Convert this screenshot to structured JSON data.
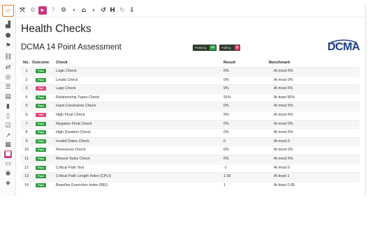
{
  "toolbar": {
    "icons": [
      "expand-icon",
      "settings-icon",
      "play-icon",
      "help-icon",
      "gear-icon",
      "back-icon",
      "home-icon",
      "forward-icon",
      "undo-icon",
      "history-icon",
      "refresh-icon",
      "download-icon"
    ]
  },
  "sidebar": {
    "icons": [
      "logo-icon",
      "chart-icon",
      "team-icon",
      "flag-icon",
      "link-icon",
      "resources-icon",
      "target-icon",
      "list-icon",
      "document-icon",
      "book-icon",
      "hint-icon",
      "check-icon",
      "trend-icon",
      "calendar-icon",
      "health-check-icon",
      "message-icon",
      "eye-icon",
      "chat-icon"
    ]
  },
  "page": {
    "title": "Health Checks",
    "subtitle": "DCMA 14 Point Assessment",
    "passing_label": "Passing",
    "passing_count": "12",
    "failing_label": "Failing",
    "failing_count": "2",
    "logo_text": "DCMA"
  },
  "table": {
    "headers": {
      "no": "No.",
      "outcome": "Outcome",
      "check": "Check",
      "result": "Result",
      "benchmark": "Benchmark"
    },
    "rows": [
      {
        "no": "1",
        "outcome": "Pass",
        "check": "Logic Check",
        "result": "0%",
        "benchmark": "At most 5%"
      },
      {
        "no": "2",
        "outcome": "Pass",
        "check": "Leads Check",
        "result": "0%",
        "benchmark": "At most 0%"
      },
      {
        "no": "3",
        "outcome": "Fail",
        "check": "Lags Check",
        "result": "9%",
        "benchmark": "At most 5%"
      },
      {
        "no": "4",
        "outcome": "Pass",
        "check": "Relationship Types Check",
        "result": "91%",
        "benchmark": "At least 90%"
      },
      {
        "no": "5",
        "outcome": "Pass",
        "check": "Hard Constraints Check",
        "result": "0%",
        "benchmark": "At most 5%"
      },
      {
        "no": "6",
        "outcome": "Fail",
        "check": "High Float Check",
        "result": "9%",
        "benchmark": "At most 5%"
      },
      {
        "no": "7",
        "outcome": "Pass",
        "check": "Negative Float Check",
        "result": "0%",
        "benchmark": "At most 0%"
      },
      {
        "no": "8",
        "outcome": "Pass",
        "check": "High Duration Check",
        "result": "0%",
        "benchmark": "At most 5%"
      },
      {
        "no": "9",
        "outcome": "Pass",
        "check": "Invalid Dates Check",
        "result": "0",
        "benchmark": "At most 0"
      },
      {
        "no": "10",
        "outcome": "Pass",
        "check": "Resources Check",
        "result": "0%",
        "benchmark": "At most 0%"
      },
      {
        "no": "11",
        "outcome": "Pass",
        "check": "Missed Tasks Check",
        "result": "0%",
        "benchmark": "At most 5%"
      },
      {
        "no": "12",
        "outcome": "Pass",
        "check": "Critical Path Test",
        "result": "-1",
        "benchmark": "At most 0"
      },
      {
        "no": "13",
        "outcome": "Pass",
        "check": "Critical Path Length Index (CPLI)",
        "result": "1.00",
        "benchmark": "At least 1"
      },
      {
        "no": "14",
        "outcome": "Pass",
        "check": "Baseline Execution Index (BEI)",
        "result": "1",
        "benchmark": "At least 0.95"
      }
    ]
  },
  "colors": {
    "pass": "#2e9e3e",
    "fail": "#e0447a",
    "accent": "#c8377f",
    "logo": "#1e3f88"
  }
}
